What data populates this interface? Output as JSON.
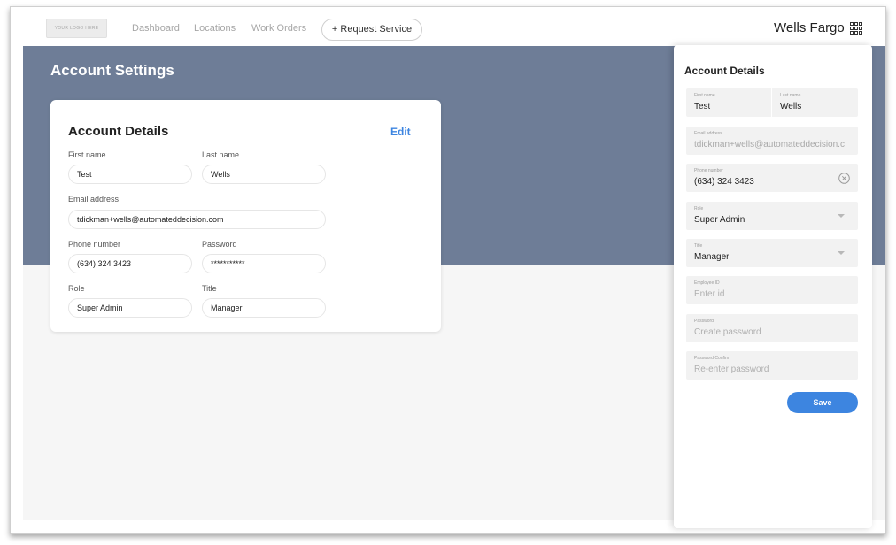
{
  "header": {
    "logo_text": "YOUR LOGO HERE",
    "nav": [
      "Dashboard",
      "Locations",
      "Work Orders"
    ],
    "request_button": "+ Request Service",
    "company": "Wells Fargo"
  },
  "page": {
    "title": "Account Settings"
  },
  "account_card": {
    "title": "Account Details",
    "edit_label": "Edit",
    "fields": {
      "first_name": {
        "label": "First name",
        "value": "Test"
      },
      "last_name": {
        "label": "Last name",
        "value": "Wells"
      },
      "email": {
        "label": "Email address",
        "value": "tdickman+wells@automateddecision.com"
      },
      "phone": {
        "label": "Phone number",
        "value": "(634) 324 3423"
      },
      "password": {
        "label": "Password",
        "value": "***********"
      },
      "role": {
        "label": "Role",
        "value": "Super Admin"
      },
      "title": {
        "label": "Title",
        "value": "Manager"
      }
    }
  },
  "drawer": {
    "title": "Account Details",
    "first_name": {
      "label": "First name",
      "value": "Test"
    },
    "last_name": {
      "label": "Last name",
      "value": "Wells"
    },
    "email": {
      "label": "Email address",
      "value": "tdickman+wells@automateddecision.c"
    },
    "phone": {
      "label": "Phone number",
      "value": "(634) 324 3423"
    },
    "role": {
      "label": "Role",
      "value": "Super Admin"
    },
    "title_field": {
      "label": "Title",
      "value": "Manager"
    },
    "employee_id": {
      "label": "Employee ID",
      "placeholder": "Enter id"
    },
    "password": {
      "label": "Password",
      "placeholder": "Create password"
    },
    "password_confirm": {
      "label": "Password Confirm",
      "placeholder": "Re-enter password"
    },
    "save_label": "Save"
  },
  "colors": {
    "banner": "#6e7d97",
    "accent": "#3d85e0"
  },
  "icons": {
    "apps": "grid-apps-icon",
    "clear": "clear-circle-icon",
    "dropdown": "chevron-down-icon"
  }
}
